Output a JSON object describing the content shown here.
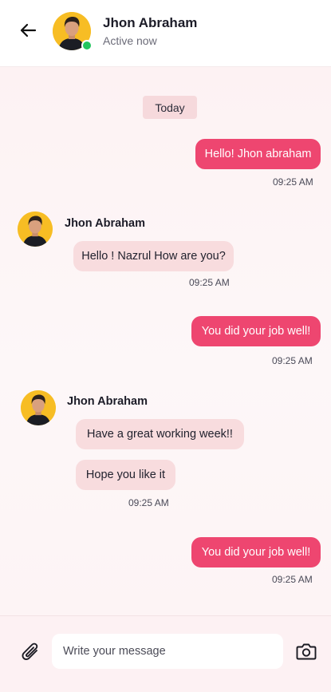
{
  "header": {
    "name": "Jhon Abraham",
    "status": "Active now"
  },
  "conversation": {
    "day_label": "Today",
    "messages": [
      {
        "direction": "outgoing",
        "text": "Hello! Jhon abraham",
        "time": "09:25 AM"
      },
      {
        "direction": "incoming",
        "sender": "Jhon Abraham",
        "text": "Hello ! Nazrul How are you?",
        "time": "09:25 AM"
      },
      {
        "direction": "outgoing",
        "text": "You did your job well!",
        "time": "09:25 AM"
      },
      {
        "direction": "incoming",
        "sender": "Jhon Abraham",
        "texts": [
          "Have a great working week!!",
          "Hope you like it"
        ],
        "time": "09:25 AM"
      },
      {
        "direction": "outgoing",
        "text": "You did your job well!",
        "time": "09:25 AM"
      }
    ]
  },
  "composer": {
    "placeholder": "Write your message",
    "attach_icon": "paperclip-icon",
    "camera_icon": "camera-icon"
  },
  "colors": {
    "accent": "#ee4670",
    "incoming_bubble": "#f8dcde",
    "avatar_bg": "#f7bd24",
    "online": "#22c55e"
  }
}
